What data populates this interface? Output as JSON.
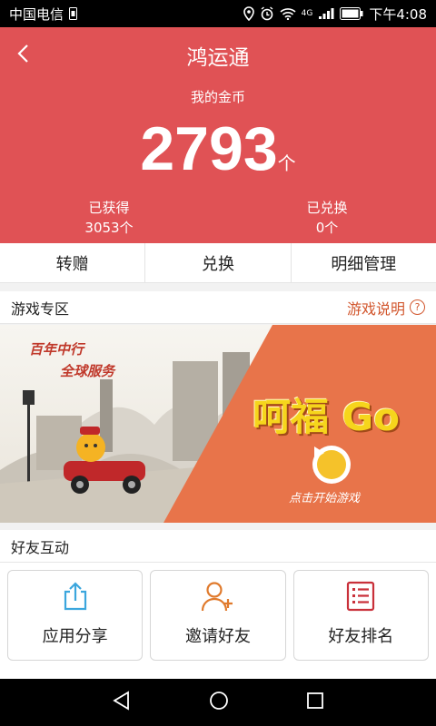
{
  "status_bar": {
    "carrier": "中国电信",
    "time": "下午4:08",
    "network": "4G"
  },
  "header": {
    "title": "鸿运通",
    "coin_label": "我的金币",
    "coin_value": "2793",
    "coin_unit": "个",
    "earned_label": "已获得",
    "earned_value": "3053个",
    "exchanged_label": "已兑换",
    "exchanged_value": "0个"
  },
  "tabs": [
    {
      "label": "转赠"
    },
    {
      "label": "兑换"
    },
    {
      "label": "明细管理"
    }
  ],
  "game_section": {
    "title": "游戏专区",
    "help_label": "游戏说明",
    "help_icon": "?",
    "banner": {
      "slogan_line1": "百年中行",
      "slogan_line2": "全球服务",
      "game_title": "呵福 Go",
      "play_hint": "点击开始游戏"
    }
  },
  "friend_section": {
    "title": "好友互动",
    "actions": [
      {
        "label": "应用分享",
        "icon": "share-icon",
        "color": "#3ba6dd"
      },
      {
        "label": "邀请好友",
        "icon": "add-user-icon",
        "color": "#e07a2c"
      },
      {
        "label": "好友排名",
        "icon": "ranking-list-icon",
        "color": "#c9303a"
      }
    ]
  },
  "colors": {
    "header_bg": "#e05255",
    "accent_orange": "#d2572e",
    "banner_orange": "#e8744a"
  }
}
